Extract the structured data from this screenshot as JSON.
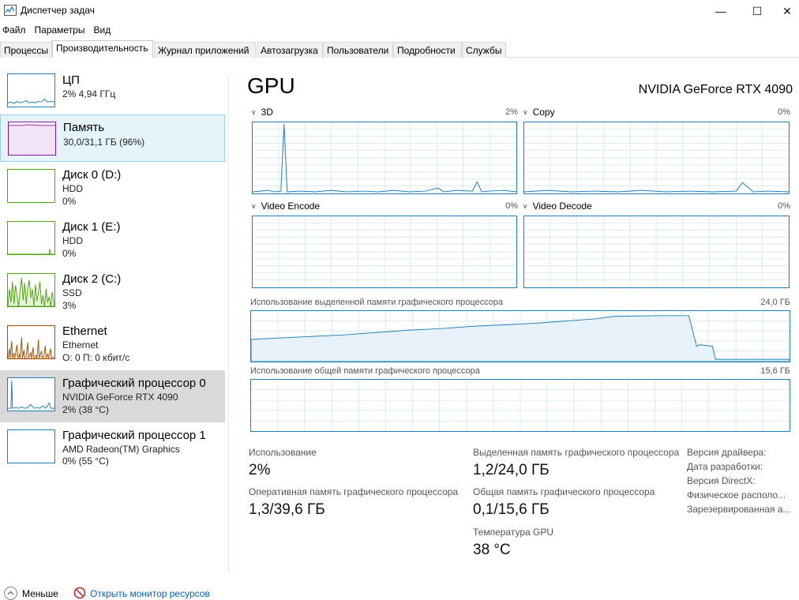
{
  "window": {
    "title": "Диспетчер задач",
    "minimize_glyph": "—",
    "maximize_glyph": "☐",
    "close_glyph": "✕"
  },
  "menu": [
    "Файл",
    "Параметры",
    "Вид"
  ],
  "tabs": [
    "Процессы",
    "Производительность",
    "Журнал приложений",
    "Автозагрузка",
    "Пользователи",
    "Подробности",
    "Службы"
  ],
  "active_tab": "Производительность",
  "sidebar": [
    {
      "title": "ЦП",
      "line1": "2% 4,94 ГГц",
      "line2": ""
    },
    {
      "title": "Память",
      "line1": "30,0/31,1 ГБ (96%)",
      "line2": ""
    },
    {
      "title": "Диск 0 (D:)",
      "line1": "HDD",
      "line2": "0%"
    },
    {
      "title": "Диск 1 (E:)",
      "line1": "HDD",
      "line2": "0%"
    },
    {
      "title": "Диск 2 (C:)",
      "line1": "SSD",
      "line2": "3%"
    },
    {
      "title": "Ethernet",
      "line1": "Ethernet",
      "line2": "О: 0 П: 0 кбит/с"
    },
    {
      "title": "Графический процессор 0",
      "line1": "NVIDIA GeForce RTX 4090",
      "line2": "2% (38 °C)"
    },
    {
      "title": "Графический процессор 1",
      "line1": "AMD Radeon(TM) Graphics",
      "line2": "0% (55 °C)"
    }
  ],
  "gpu": {
    "heading": "GPU",
    "model": "NVIDIA GeForce RTX 4090",
    "engines": [
      {
        "name": "3D",
        "percent": "2%"
      },
      {
        "name": "Copy",
        "percent": "0%"
      },
      {
        "name": "Video Encode",
        "percent": "0%"
      },
      {
        "name": "Video Decode",
        "percent": "0%"
      }
    ],
    "dedicated_mem_label": "Использование выделенной памяти графического процессора",
    "dedicated_mem_max": "24,0 ГБ",
    "shared_mem_label": "Использование общей памяти графического процессора",
    "shared_mem_max": "15,6 ГБ"
  },
  "stats": {
    "usage_label": "Использование",
    "usage_value": "2%",
    "dedicated_label": "Выделенная память графического процессора",
    "dedicated_value": "1,2/24,0 ГБ",
    "ram_label": "Оперативная память графического процессора",
    "ram_value": "1,3/39,6 ГБ",
    "shared_label": "Общая память графического процессора",
    "shared_value": "0,1/15,6 ГБ",
    "temp_label": "Температура GPU",
    "temp_value": "38 °C"
  },
  "info": [
    "Версия драйвера:",
    "Дата разработки:",
    "Версия DirectX:",
    "Физическое располо...",
    "Зарезервированная а..."
  ],
  "footer": {
    "fewer": "Меньше",
    "monitor_link": "Открыть монитор ресурсов"
  },
  "colors": {
    "gpu_line": "#1f7ebc",
    "memory_line": "#8b12ae",
    "disk_line": "#4da60c",
    "ethernet_line": "#a74f01",
    "link": "#0066cc"
  }
}
